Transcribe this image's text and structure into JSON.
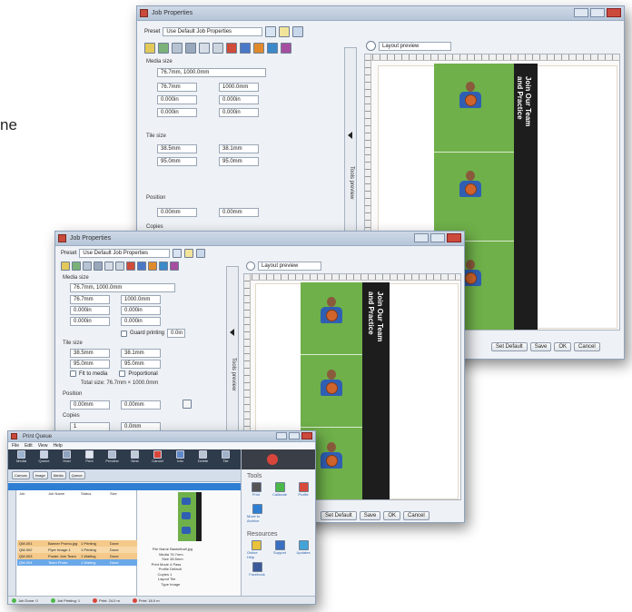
{
  "edge_text": "ne",
  "window_back": {
    "title": "Job Properties",
    "preset_label": "Preset",
    "preset_value": "Use Default Job Properties",
    "section_media_size": "Media size",
    "media_size_value": "76.7mm, 1000.0mm",
    "fields": [
      "76.7mm",
      "1000.0mm",
      "0.000in",
      "0.000in",
      "0.000in",
      "0.000in"
    ],
    "section_tile_size": "Tile size",
    "tile_fields": [
      "38.5mm",
      "38.1mm",
      "95.0mm",
      "95.0mm"
    ],
    "section_position": "Position",
    "position_fields": [
      "0.00mm",
      "0.00mm"
    ],
    "section_copies": "Copies",
    "preview_dropdown": "Layout preview",
    "side_tab": "Tools preview",
    "bottom_buttons": [
      "Set Default",
      "Save",
      "OK",
      "Cancel"
    ],
    "band_text": [
      "Join Our Team",
      "and Practice"
    ]
  },
  "window_mid": {
    "title": "Job Properties",
    "preset_label": "Preset",
    "preset_value": "Use Default Job Properties",
    "section_media_size": "Media size",
    "media_size_value": "76.7mm, 1000.0mm",
    "media_fields": [
      "76.7mm",
      "1000.0mm",
      "0.000in",
      "0.000in",
      "0.000in",
      "0.000in"
    ],
    "guard_label": "Guard printing",
    "guard_value": "0.0in",
    "section_tile_size": "Tile size",
    "tile_fields": [
      "38.5mm",
      "38.1mm",
      "95.0mm",
      "95.0mm"
    ],
    "fit_label": "Fit to media",
    "prop_label": "Proportional",
    "total_label": "Total size: 76.7mm × 1000.0mm",
    "section_position": "Position",
    "position_fields": [
      "0.00mm",
      "0.00mm"
    ],
    "section_copies": "Copies",
    "copies_fields": [
      "1",
      "0.0mm"
    ],
    "preview_dropdown": "Layout preview",
    "side_tab": "Tools preview",
    "bottom_buttons": [
      "Set Default",
      "Save",
      "OK",
      "Cancel"
    ],
    "band_text": [
      "Join Our Team",
      "and Practice"
    ]
  },
  "window_front": {
    "title": "Print Queue",
    "menu": [
      "File",
      "Edit",
      "View",
      "Help"
    ],
    "toolbar": [
      "Media",
      "Queue",
      "Hold",
      "Print",
      "Preview",
      "Nest",
      "Cancel",
      "Info",
      "Delete",
      "Tile"
    ],
    "tabs": [
      "Canvas",
      "Image",
      "Media",
      "Queue"
    ],
    "list_headers": [
      "Job",
      "Job Name",
      "Status",
      "Size"
    ],
    "list_rows": [
      [
        "QM-001",
        "Banner Promo.jpg",
        "1 Printing",
        "Done"
      ],
      [
        "QM-002",
        "Flyer Image-1",
        "1 Printing",
        "Done"
      ],
      [
        "QM-003",
        "Poster Join Team",
        "1 Waiting",
        "Done"
      ],
      [
        "QM-004",
        "Team Photo",
        "1 Waiting",
        "Done"
      ]
    ],
    "info_labels": [
      "File Name",
      "Media",
      "Size",
      "Print Mode",
      "Profile",
      "Copies",
      "Layout",
      "Type"
    ],
    "info_values": [
      "Basketball.jpg",
      "76.7mm",
      "38.5mm",
      "4 Pass",
      "Default",
      "1",
      "Tile",
      "Image"
    ],
    "tools_title": "Tools",
    "tools_items": [
      "Print",
      "Calibrate",
      "Profile",
      "Move to Archive"
    ],
    "resources_title": "Resources",
    "resources_items": [
      "Online Help",
      "Support",
      "Updates",
      "Facebook"
    ],
    "status_items": [
      "Job Done: 0",
      "Job Printing: 1",
      "Print: 24.0 m",
      "Print: 18.0 m"
    ],
    "band_text": [
      "Join Our",
      "Team"
    ]
  },
  "colors": {
    "window_bg": "#eef1f5",
    "titlebar": "#b5c5d8",
    "grass": "#6fb04a",
    "band": "#1d1d1d",
    "jersey": "#2f5fb3",
    "ball": "#d0652c",
    "dark_toolbar": "#2d3b4a",
    "selection": "#2e7fd4"
  }
}
